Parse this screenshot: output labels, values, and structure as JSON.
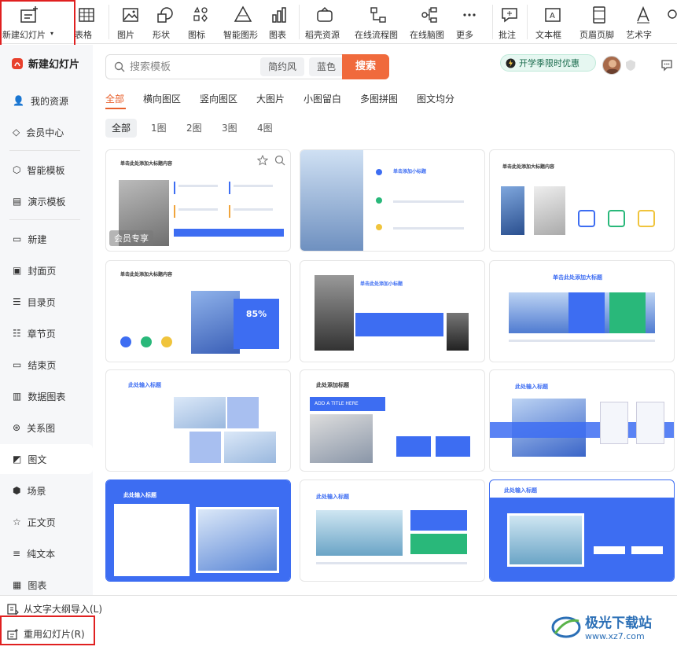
{
  "toolbar": {
    "new_slide": "新建幻灯片",
    "table": "表格",
    "picture": "图片",
    "shape": "形状",
    "icon": "图标",
    "smart_graphic": "智能图形",
    "chart": "图表",
    "daoke": "稻壳资源",
    "flowchart": "在线流程图",
    "mindmap": "在线脑图",
    "more": "更多",
    "comment": "批注",
    "textbox": "文本框",
    "header_footer": "页眉页脚",
    "wordart": "艺术字"
  },
  "sidebar": {
    "title": "新建幻灯片",
    "items": [
      "我的资源",
      "会员中心",
      "智能模板",
      "演示模板",
      "新建",
      "封面页",
      "目录页",
      "章节页",
      "结束页",
      "数据图表",
      "关系图",
      "图文",
      "场景",
      "正文页",
      "纯文本",
      "图表"
    ],
    "active": "图文"
  },
  "search": {
    "placeholder": "搜索模板",
    "chip1": "简约风",
    "chip2": "蓝色",
    "button": "搜索"
  },
  "promo": "开学季限时优惠",
  "categories": [
    "全部",
    "横向图区",
    "竖向图区",
    "大图片",
    "小图留白",
    "多图拼图",
    "图文均分"
  ],
  "filters": [
    "全部",
    "1图",
    "2图",
    "3图",
    "4图"
  ],
  "cards": [
    {
      "title": "单击此处添加大标题内容",
      "badge": "会员专享"
    },
    {
      "title": "单击添加小标题"
    },
    {
      "title": "单击此处添加大标题内容"
    },
    {
      "title": "单击此处添加大标题内容",
      "value": "85%"
    },
    {
      "title": "单击此处添加小标题"
    },
    {
      "title": "单击此处添加大标题"
    },
    {
      "title": "此处输入标题"
    },
    {
      "title": "此处添加标题",
      "sub": "ADD A TITLE HERE"
    },
    {
      "title": "此处输入标题"
    },
    {
      "title": "此处输入标题"
    },
    {
      "title": "此处输入标题"
    },
    {
      "title": "此处输入标题"
    }
  ],
  "bottom": {
    "import_outline": "从文字大纲导入(L)",
    "reuse_slides": "重用幻灯片(R)"
  },
  "watermark": {
    "name": "极光下载站",
    "url": "www.xz7.com"
  },
  "colors": {
    "accent": "#e8602c",
    "search_btn": "#f06a3c",
    "highlight": "#e02020",
    "template_blue": "#3d6df2"
  }
}
